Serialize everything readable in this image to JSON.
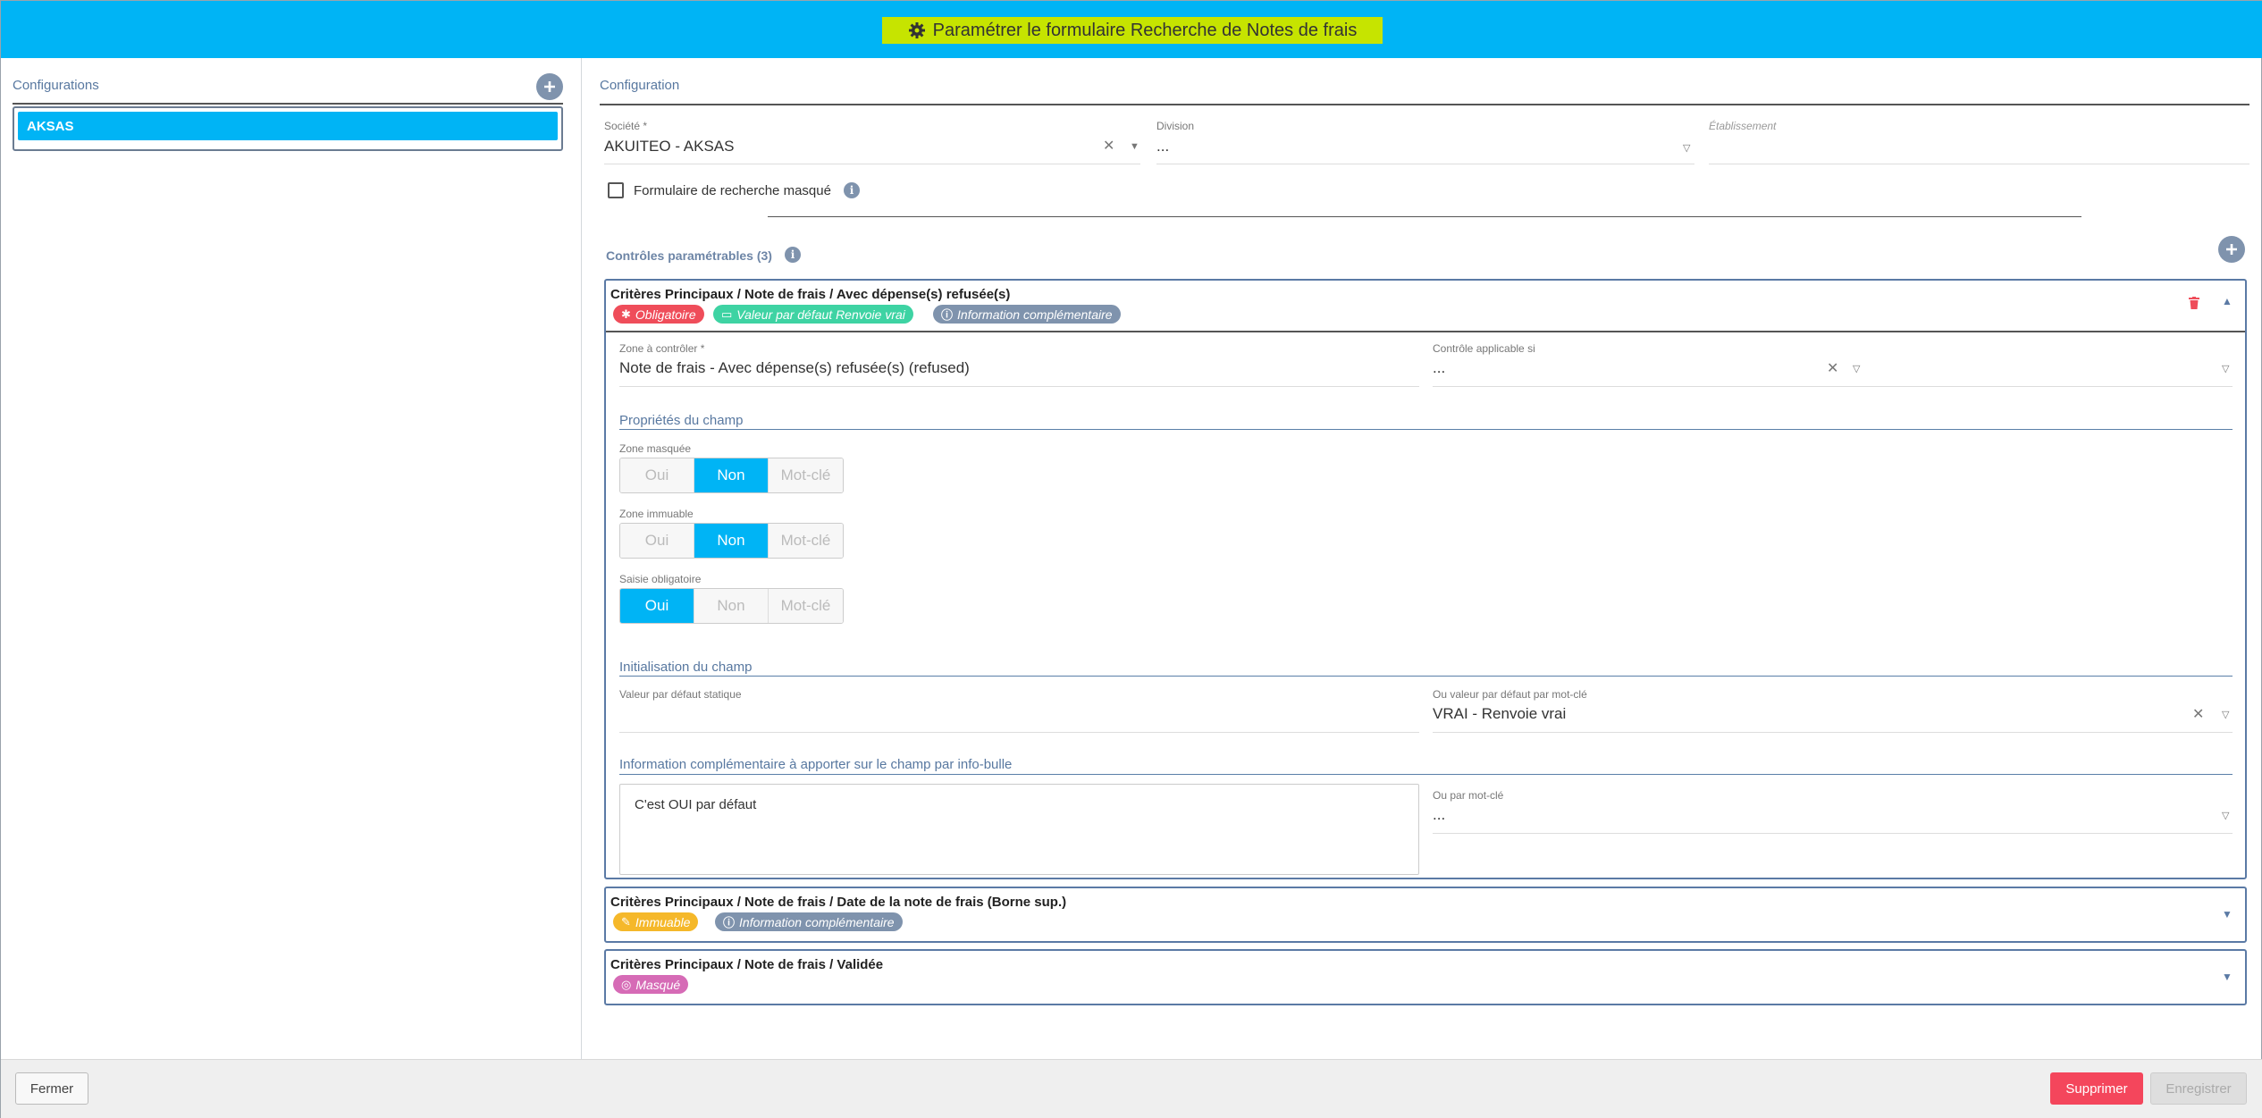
{
  "header": {
    "title": "Paramétrer le formulaire Recherche de Notes de frais"
  },
  "sidebar": {
    "title": "Configurations",
    "items": [
      "AKSAS"
    ]
  },
  "main": {
    "title": "Configuration",
    "societe": {
      "label": "Société *",
      "value": "AKUITEO - AKSAS"
    },
    "division": {
      "label": "Division",
      "value": "..."
    },
    "etablissement": {
      "label": "Établissement",
      "value": ""
    },
    "hidden_form_label": "Formulaire de recherche masqué",
    "controls_title": "Contrôles paramétrables (3)",
    "controls": [
      {
        "title": "Critères Principaux / Note de frais / Avec dépense(s) refusée(s)",
        "badges": [
          {
            "icon": "✱",
            "label": "Obligatoire",
            "color": "#ef4d5a"
          },
          {
            "icon": "▭",
            "label": "Valeur par défaut Renvoie vrai",
            "color": "#3ed3a3"
          },
          {
            "icon": "i",
            "label": "Information complémentaire",
            "color": "#7f93ad"
          }
        ],
        "zone_label": "Zone à contrôler *",
        "zone_value": "Note de frais - Avec dépense(s) refusée(s) (refused)",
        "condition_label": "Contrôle applicable si",
        "condition_value": "...",
        "props_title": "Propriétés du champ",
        "props": [
          {
            "label": "Zone masquée",
            "options": [
              "Oui",
              "Non",
              "Mot-clé"
            ],
            "selected": 1
          },
          {
            "label": "Zone immuable",
            "options": [
              "Oui",
              "Non",
              "Mot-clé"
            ],
            "selected": 1
          },
          {
            "label": "Saisie obligatoire",
            "options": [
              "Oui",
              "Non",
              "Mot-clé"
            ],
            "selected": 0
          }
        ],
        "init_title": "Initialisation du champ",
        "static_label": "Valeur par défaut statique",
        "static_value": "",
        "keyword_label": "Ou valeur par défaut par mot-clé",
        "keyword_value": "VRAI - Renvoie vrai",
        "info_title": "Information complémentaire à apporter sur le champ par info-bulle",
        "info_text": "C'est OUI par défaut",
        "info_keyword_label": "Ou par mot-clé",
        "info_keyword_value": "..."
      },
      {
        "title": "Critères Principaux / Note de frais / Date de la note de frais (Borne sup.)",
        "badges": [
          {
            "icon": "✎",
            "label": "Immuable",
            "color": "#f5b82a"
          },
          {
            "icon": "i",
            "label": "Information complémentaire",
            "color": "#7f93ad"
          }
        ]
      },
      {
        "title": "Critères Principaux / Note de frais / Validée",
        "badges": [
          {
            "icon": "◎",
            "label": "Masqué",
            "color": "#d66bb6"
          }
        ]
      }
    ]
  },
  "footer": {
    "close": "Fermer",
    "delete": "Supprimer",
    "save": "Enregistrer"
  }
}
